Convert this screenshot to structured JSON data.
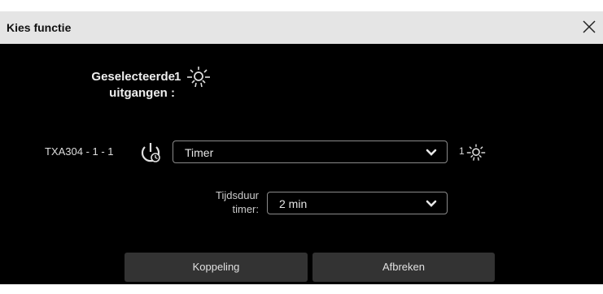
{
  "dialog": {
    "title": "Kies functie",
    "close_icon": "close-icon"
  },
  "selected": {
    "label_line1": "Geselecteerde",
    "label_line2": "uitgangen :",
    "count": "1",
    "icon": "light-bulb-icon"
  },
  "output": {
    "name": "TXA304 - 1 - 1",
    "icon": "power-timer-icon",
    "function_value": "Timer",
    "count": "1",
    "count_icon": "light-bulb-icon"
  },
  "timer": {
    "label_line1": "Tijdsduur",
    "label_line2": "timer:",
    "value": "2 min"
  },
  "buttons": {
    "koppeling": "Koppeling",
    "afbreken": "Afbreken"
  }
}
